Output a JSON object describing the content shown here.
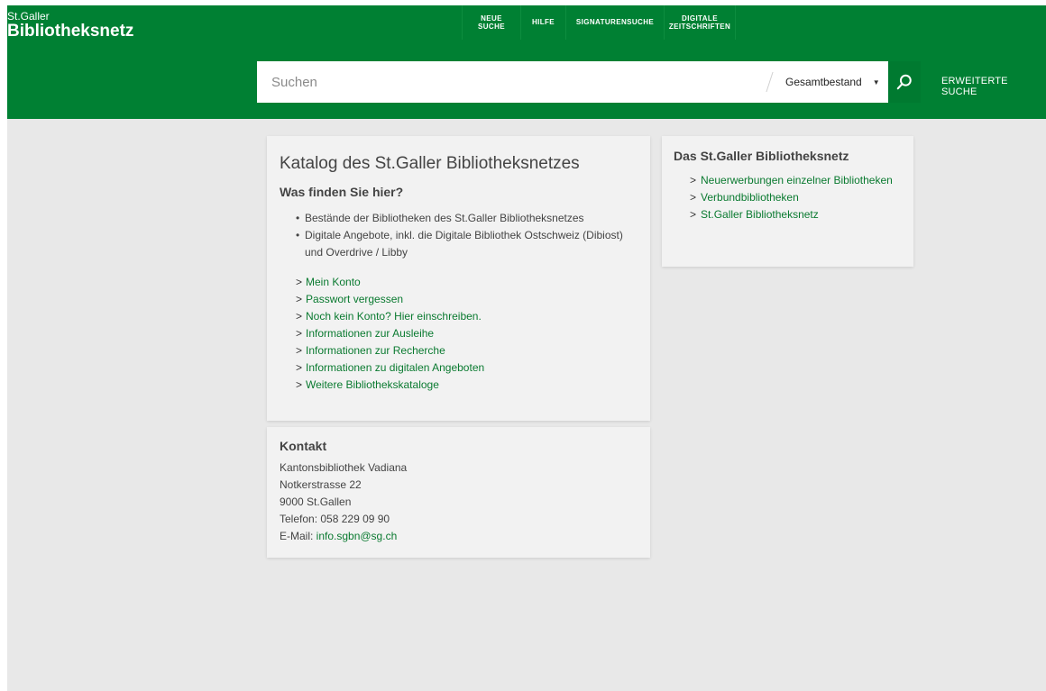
{
  "header": {
    "logo_small": "St.Galler",
    "logo_big": "Bibliotheksnetz",
    "nav": [
      {
        "line1": "NEUE",
        "line2": "SUCHE"
      },
      {
        "line1": "HILFE",
        "line2": ""
      },
      {
        "line1": "SIGNATURENSUCHE",
        "line2": ""
      },
      {
        "line1": "DIGITALE",
        "line2": "ZEITSCHRIFTEN"
      }
    ],
    "colors": {
      "header_bg": "#008033",
      "link": "#0a7a30",
      "page_bg": "#e8e8e8"
    }
  },
  "search": {
    "placeholder": "Suchen",
    "value": "",
    "scope_selected": "Gesamtbestand",
    "search_icon": "search-icon",
    "advanced_label": "ERWEITERTE SUCHE"
  },
  "main": {
    "title": "Katalog des St.Galler Bibliotheksnetzes",
    "subtitle": "Was finden Sie hier?",
    "bullets": [
      "Bestände der Bibliotheken des St.Galler Bibliotheksnetzes",
      "Digitale Angebote, inkl. die Digitale Bibliothek Ostschweiz (Dibiost) und Overdrive / Libby"
    ],
    "links": [
      "Mein Konto",
      "Passwort vergessen",
      "Noch kein Konto? Hier einschreiben.",
      "Informationen zur Ausleihe",
      "Informationen zur Recherche",
      "Informationen zu digitalen Angeboten",
      "Weitere Bibliothekskataloge"
    ]
  },
  "contact": {
    "title": "Kontakt",
    "lines": [
      "Kantonsbibliothek Vadiana",
      "Notkerstrasse 22",
      "9000 St.Gallen",
      "Telefon: 058 229 09 90"
    ],
    "email_label": "E-Mail: ",
    "email": "info.sgbn@sg.ch"
  },
  "side": {
    "title": "Das St.Galler Bibliotheksnetz",
    "links": [
      "Neuerwerbungen einzelner Bibliotheken",
      "Verbundbibliotheken",
      "St.Galler Bibliotheksnetz"
    ]
  },
  "glyphs": {
    "gt": ">",
    "bullet": "•",
    "caret": "▼"
  }
}
